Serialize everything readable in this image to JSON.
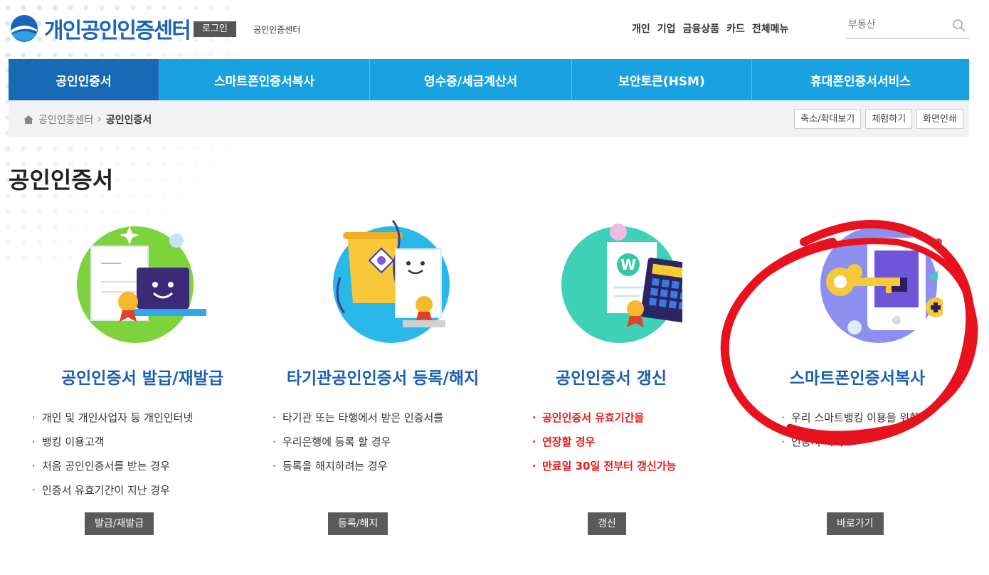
{
  "header": {
    "logo_text": "개인공인인증센터",
    "login_label": "로그인",
    "crumb_title": "공인인증센터",
    "topnav": [
      "개인",
      "기업",
      "금융상품",
      "카드",
      "전체메뉴"
    ],
    "search_placeholder": "부동산"
  },
  "nav": {
    "items": [
      "공인인증서",
      "스마트폰인증서복사",
      "영수증/세금계산서",
      "보안토큰(HSM)",
      "휴대폰인증서서비스"
    ]
  },
  "breadcrumb": {
    "home": "공인인증센터",
    "separator": "›",
    "current": "공인인증서",
    "tools": [
      "축소/확대보기",
      "체험하기",
      "화면인쇄"
    ]
  },
  "page_title": "공인인증서",
  "cards": [
    {
      "title": "공인인증서 발급/재발급",
      "bullets": [
        "개인 및 개인사업자 등 개인인터넷",
        "뱅킹 이용고객",
        "처음 공인인증서를 받는 경우",
        "인증서 유효기간이 지난 경우"
      ],
      "button": "발급/재발급"
    },
    {
      "title": "타기관공인인증서 등록/해지",
      "bullets": [
        "타기관 또는 타행에서 받은 인증서를",
        "우리은행에 등록 할 경우",
        "등록을 해지하려는 경우"
      ],
      "button": "등록/해지"
    },
    {
      "title": "공인인증서 갱신",
      "bullets": [
        "공인인증서 유효기간을",
        "연장할 경우",
        "만료일 30일 전부터 갱신가능"
      ],
      "button": "갱신"
    },
    {
      "title": "스마트폰인증서복사",
      "bullets": [
        "우리 스마트뱅킹 이용을 위한",
        "인증서 복사"
      ],
      "button": "바로가기"
    }
  ],
  "colors": {
    "nav_bg": "#1aa2e0",
    "nav_active": "#1869b4",
    "title_blue": "#1a5fb0",
    "highlight_red": "#e02020"
  }
}
